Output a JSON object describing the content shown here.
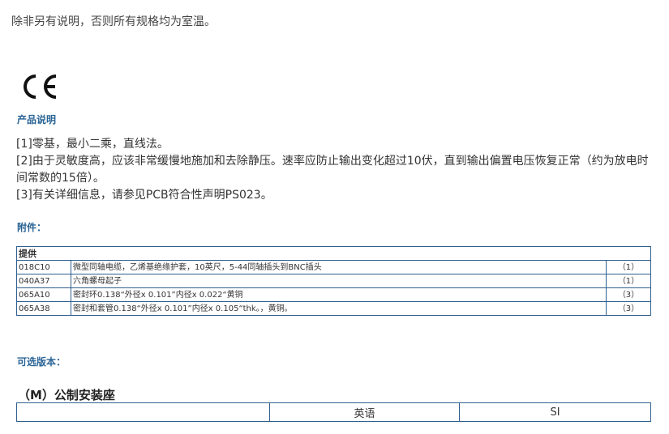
{
  "top_note": "除非另有说明，否则所有规格均为室温。",
  "ce_mark": "CE",
  "description": {
    "title": "产品说明",
    "notes": [
      "[1]零基，最小二乘，直线法。",
      "[2]由于灵敏度高，应该非常缓慢地施加和去除静压。速率应防止输出变化超过10伏，直到输出偏置电压恢复正常（约为放电时间常数的15倍）。",
      "[3]有关详细信息，请参见PCB符合性声明PS023。"
    ]
  },
  "accessories": {
    "title": "附件：",
    "header": "提供",
    "rows": [
      {
        "code": "018C10",
        "desc": "微型同轴电缆，乙烯基绝缘护套，10英尺，5-44同轴插头到BNC插头",
        "qty": "（1）"
      },
      {
        "code": "040A37",
        "desc": "六角螺母起子",
        "qty": "（1）"
      },
      {
        "code": "065A10",
        "desc": "密封环0.138“外径x 0.101”内径x 0.022“黄铜",
        "qty": "（3）"
      },
      {
        "code": "065A38",
        "desc": "密封和套管0.138“外径x 0.101”内径x 0.105“thk。，黄铜。",
        "qty": "（3）"
      }
    ]
  },
  "optional_versions": {
    "title": "可选版本：",
    "version_title": "（M）公制安装座",
    "columns": [
      "",
      "英语",
      "SI"
    ]
  }
}
